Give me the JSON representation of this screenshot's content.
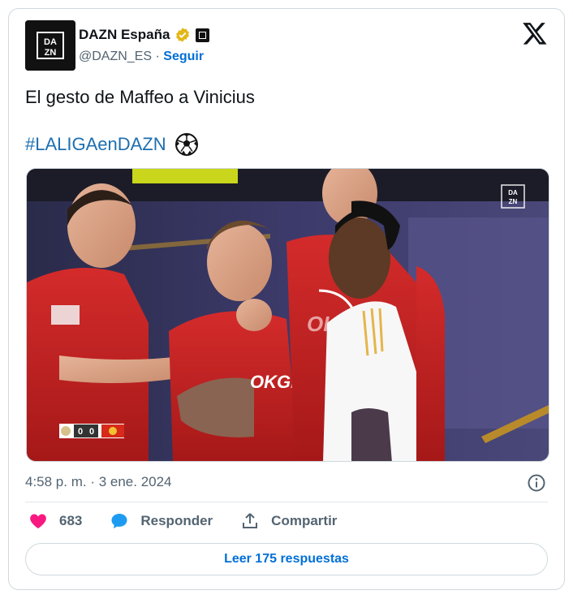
{
  "author": {
    "name": "DAZN España",
    "handle": "@DAZN_ES",
    "separator": "·",
    "follow_label": "Seguir",
    "avatar_text": "DAZN"
  },
  "tweet": {
    "text": "El gesto de Maffeo a Vinicius",
    "hashtag": "#LALIGAenDAZN",
    "emoji": "⚽"
  },
  "media": {
    "watermark": "DAZN",
    "scoreboard": [
      "0",
      "0"
    ]
  },
  "meta": {
    "timestamp": "4:58 p. m. · 3 ene. 2024"
  },
  "actions": {
    "likes": "683",
    "reply_label": "Responder",
    "share_label": "Compartir"
  },
  "replies_button": "Leer 175 respuestas",
  "colors": {
    "link": "#006fd6",
    "hashtag": "#1d6fb0",
    "like": "#f91880",
    "reply": "#1d9bf0",
    "verified": "#e2b719"
  }
}
